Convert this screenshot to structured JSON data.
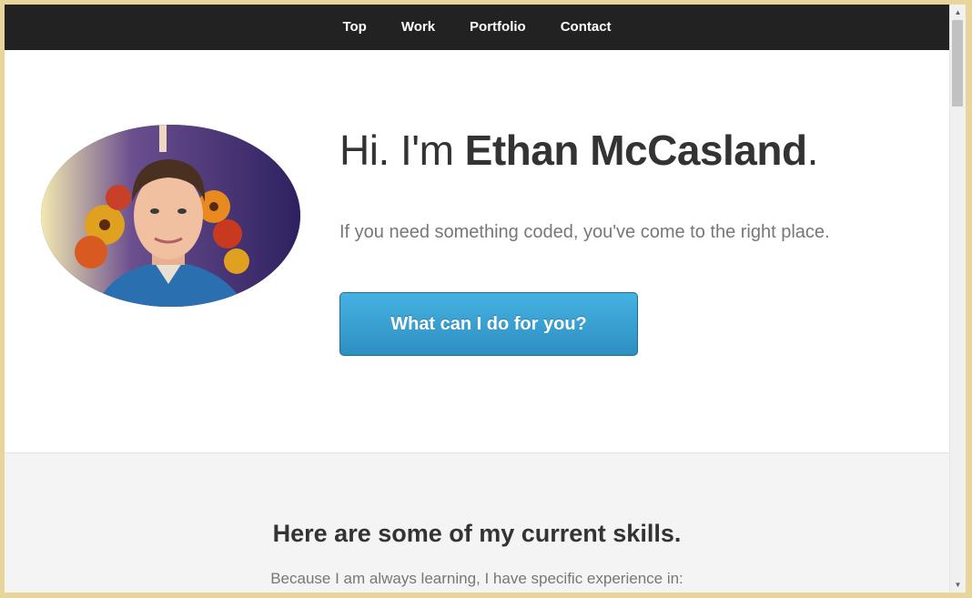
{
  "nav": {
    "items": [
      {
        "label": "Top"
      },
      {
        "label": "Work"
      },
      {
        "label": "Portfolio"
      },
      {
        "label": "Contact"
      }
    ]
  },
  "hero": {
    "greeting": "Hi. I'm ",
    "name": "Ethan McCasland",
    "period": ".",
    "subtitle": "If you need something coded, you've come to the right place.",
    "cta_label": "What can I do for you?"
  },
  "skills": {
    "title": "Here are some of my current skills.",
    "subtitle": "Because I am always learning, I have specific experience in:"
  },
  "colors": {
    "navbar": "#222222",
    "cta": "#3aa3d6",
    "window_frame": "#e8d59a"
  },
  "icons": {
    "scroll_up": "triangle-up-icon",
    "scroll_down": "triangle-down-icon"
  }
}
